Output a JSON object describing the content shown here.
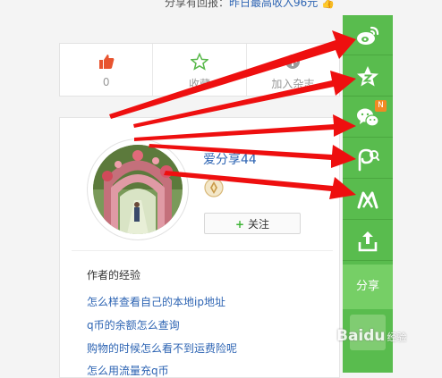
{
  "top_note": {
    "prefix": "分享有回报：",
    "highlight": "昨日最高收入96元"
  },
  "actions": [
    {
      "label": "0",
      "icon": "thumbs-up-icon"
    },
    {
      "label": "收藏",
      "icon": "star-outline-icon"
    },
    {
      "label": "加入杂志",
      "icon": "plus-circle-icon"
    }
  ],
  "author": {
    "username": "爱分享44",
    "follow_label": "关注"
  },
  "experiences": {
    "title": "作者的经验",
    "items": [
      "怎么样查看自己的本地ip地址",
      "q币的余额怎么查询",
      "购物的时候怎么看不到运费险呢",
      "怎么用流量充q币"
    ]
  },
  "share": {
    "label": "分享",
    "new_badge": "N",
    "buttons": [
      "weibo-icon",
      "qzone-icon",
      "wechat-icon",
      "friend-circle-icon",
      "tieba-icon",
      "upload-share-icon"
    ]
  },
  "watermark": {
    "text": "Baidu",
    "sub": "经验"
  },
  "colors": {
    "rail": "#59bc4e",
    "share_active": "#76cf66",
    "arrow": "#ee0f0f",
    "link": "#2d64b3"
  }
}
